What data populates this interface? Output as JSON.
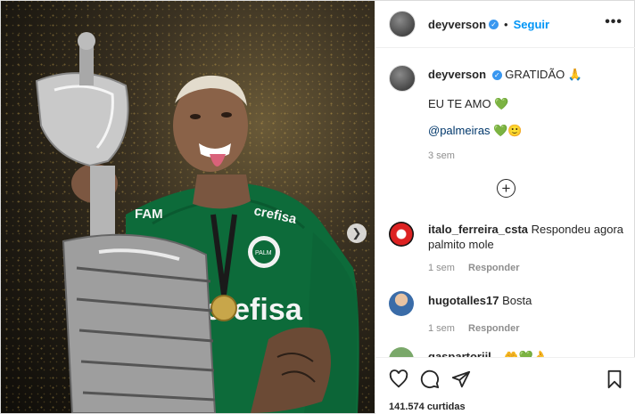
{
  "post": {
    "username": "deyverson",
    "follow_label": "Seguir",
    "more_label": "•••"
  },
  "caption": {
    "username": "deyverson",
    "text": "GRATIDÃO 🙏",
    "line2": "EU TE AMO 💚",
    "mention": "@palmeiras",
    "mention_emoji": "💚🙂",
    "time": "3 sem"
  },
  "comments": [
    {
      "username": "italo_ferreira_csta",
      "text": "Respondeu agora palmito mole",
      "time": "1 sem",
      "reply_label": "Responder"
    },
    {
      "username": "hugotalles17",
      "text": "Bosta",
      "time": "1 sem",
      "reply_label": "Responder"
    },
    {
      "username": "gaspartoriil...",
      "text": "🤲💚👌"
    }
  ],
  "likes": "141.574 curtidas",
  "icons": [
    "heart-icon",
    "comment-icon",
    "share-icon",
    "bookmark-icon",
    "chevron-right-icon",
    "add-circle-icon",
    "verified-icon",
    "more-icon"
  ],
  "colors": {
    "link_blue": "#0095f6",
    "mention": "#00376b",
    "meta_gray": "#8e8e8e",
    "jersey_green": "#0d6b3a"
  }
}
